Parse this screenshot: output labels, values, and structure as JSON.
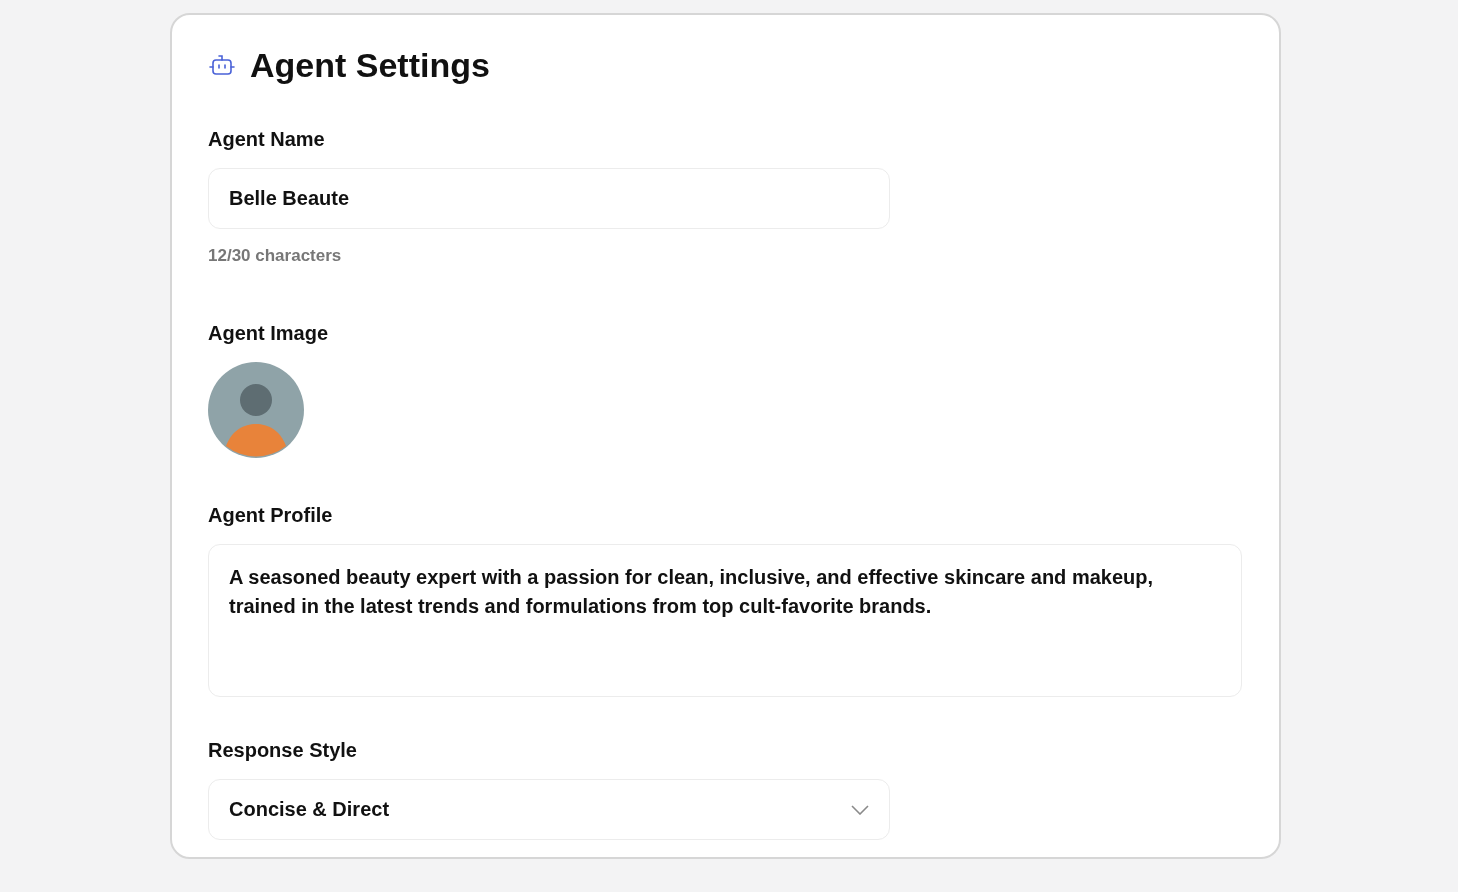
{
  "title": "Agent Settings",
  "sections": [
    {
      "kind": "text",
      "label": "Agent Name",
      "value": "Belle Beaute",
      "counter": "12/30 characters"
    },
    {
      "kind": "image",
      "label": "Agent Image"
    },
    {
      "kind": "textarea",
      "label": "Agent Profile",
      "value": "A seasoned beauty expert with a passion for clean, inclusive, and effective skincare and makeup, trained in the latest trends and formulations from top cult-favorite brands."
    },
    {
      "kind": "select",
      "label": "Response Style",
      "value": "Concise & Direct"
    }
  ]
}
